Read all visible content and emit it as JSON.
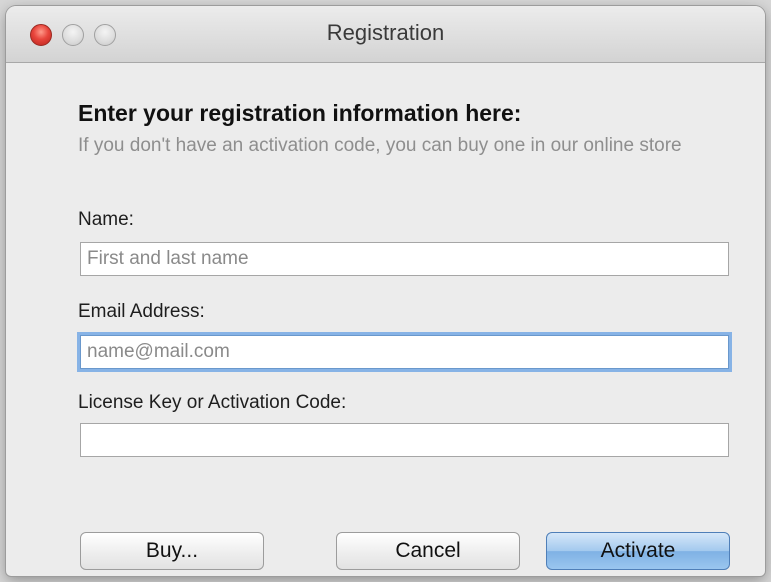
{
  "window": {
    "title": "Registration"
  },
  "header": {
    "heading": "Enter your registration information here:",
    "subtext": "If you don't have an activation code, you can buy one in our online store"
  },
  "form": {
    "name_label": "Name:",
    "name_placeholder": "First and last name",
    "name_value": "",
    "email_label": "Email Address:",
    "email_placeholder": "name@mail.com",
    "email_value": "",
    "license_label": "License Key or Activation Code:",
    "license_placeholder": "",
    "license_value": ""
  },
  "buttons": {
    "buy_label": "Buy...",
    "cancel_label": "Cancel",
    "activate_label": "Activate"
  },
  "colors": {
    "close_button": "#e8453c",
    "focus_ring": "#87b3e6",
    "default_button": "#9ac6ef"
  },
  "icons": {
    "close": "close-icon",
    "minimize": "minimize-icon",
    "zoom": "zoom-icon"
  }
}
